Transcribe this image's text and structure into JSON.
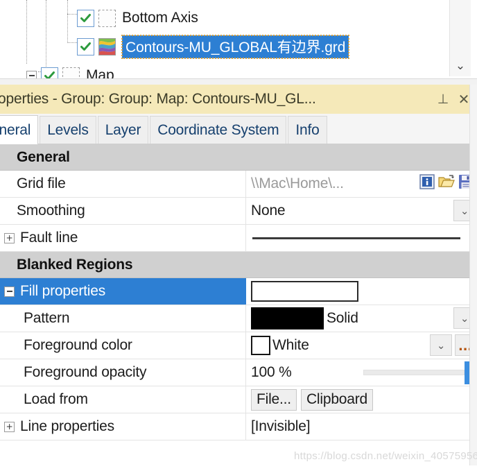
{
  "tree": {
    "items": [
      {
        "label": "Bottom Axis",
        "checked": true,
        "icon": "blank-page-icon",
        "selected": false,
        "expander": "none"
      },
      {
        "label": "Contours-MU_GLOBAL有边界.grd",
        "checked": true,
        "icon": "contour-grid-icon",
        "selected": true,
        "expander": "none"
      },
      {
        "label": "Map",
        "checked": true,
        "icon": "blank-page-icon",
        "selected": false,
        "expander": "minus"
      }
    ],
    "scroll_arrow": "⌄"
  },
  "panel": {
    "title": "operties - Group: Group: Map: Contours-MU_GL...",
    "pin_icon": "⊥",
    "close_icon": "✕",
    "tabs": [
      {
        "label": "eneral",
        "active": true
      },
      {
        "label": "Levels",
        "active": false
      },
      {
        "label": "Layer",
        "active": false
      },
      {
        "label": "Coordinate System",
        "active": false
      },
      {
        "label": "Info",
        "active": false
      }
    ],
    "rows": [
      {
        "type": "section",
        "label": "General"
      },
      {
        "type": "file",
        "label": "Grid file",
        "value": "\\\\Mac\\Home\\...",
        "icons": [
          "info-icon",
          "open-folder-icon",
          "save-disk-icon"
        ]
      },
      {
        "type": "combo",
        "label": "Smoothing",
        "value": "None"
      },
      {
        "type": "line",
        "label": "Fault line",
        "value": "",
        "expander": "plus"
      },
      {
        "type": "section",
        "label": "Blanked Regions"
      },
      {
        "type": "preview",
        "label": "Fill properties",
        "value": "",
        "expander": "minus",
        "selected": true
      },
      {
        "type": "pattern",
        "label": "Pattern",
        "value": "Solid"
      },
      {
        "type": "color",
        "label": "Foreground color",
        "value": "White"
      },
      {
        "type": "slider",
        "label": "Foreground opacity",
        "value": "100 %"
      },
      {
        "type": "buttons",
        "label": "Load from",
        "buttons": [
          "File...",
          "Clipboard"
        ]
      },
      {
        "type": "text",
        "label": "Line properties",
        "value": "[Invisible]",
        "expander": "plus"
      }
    ]
  },
  "watermark": "https://blog.csdn.net/weixin_40575956",
  "colors": {
    "selection_blue": "#2d7fd3",
    "title_bar": "#f5e9b9",
    "section_header": "#d0d0d0",
    "slider_thumb": "#3b8ee0",
    "tab_text": "#16406e"
  }
}
